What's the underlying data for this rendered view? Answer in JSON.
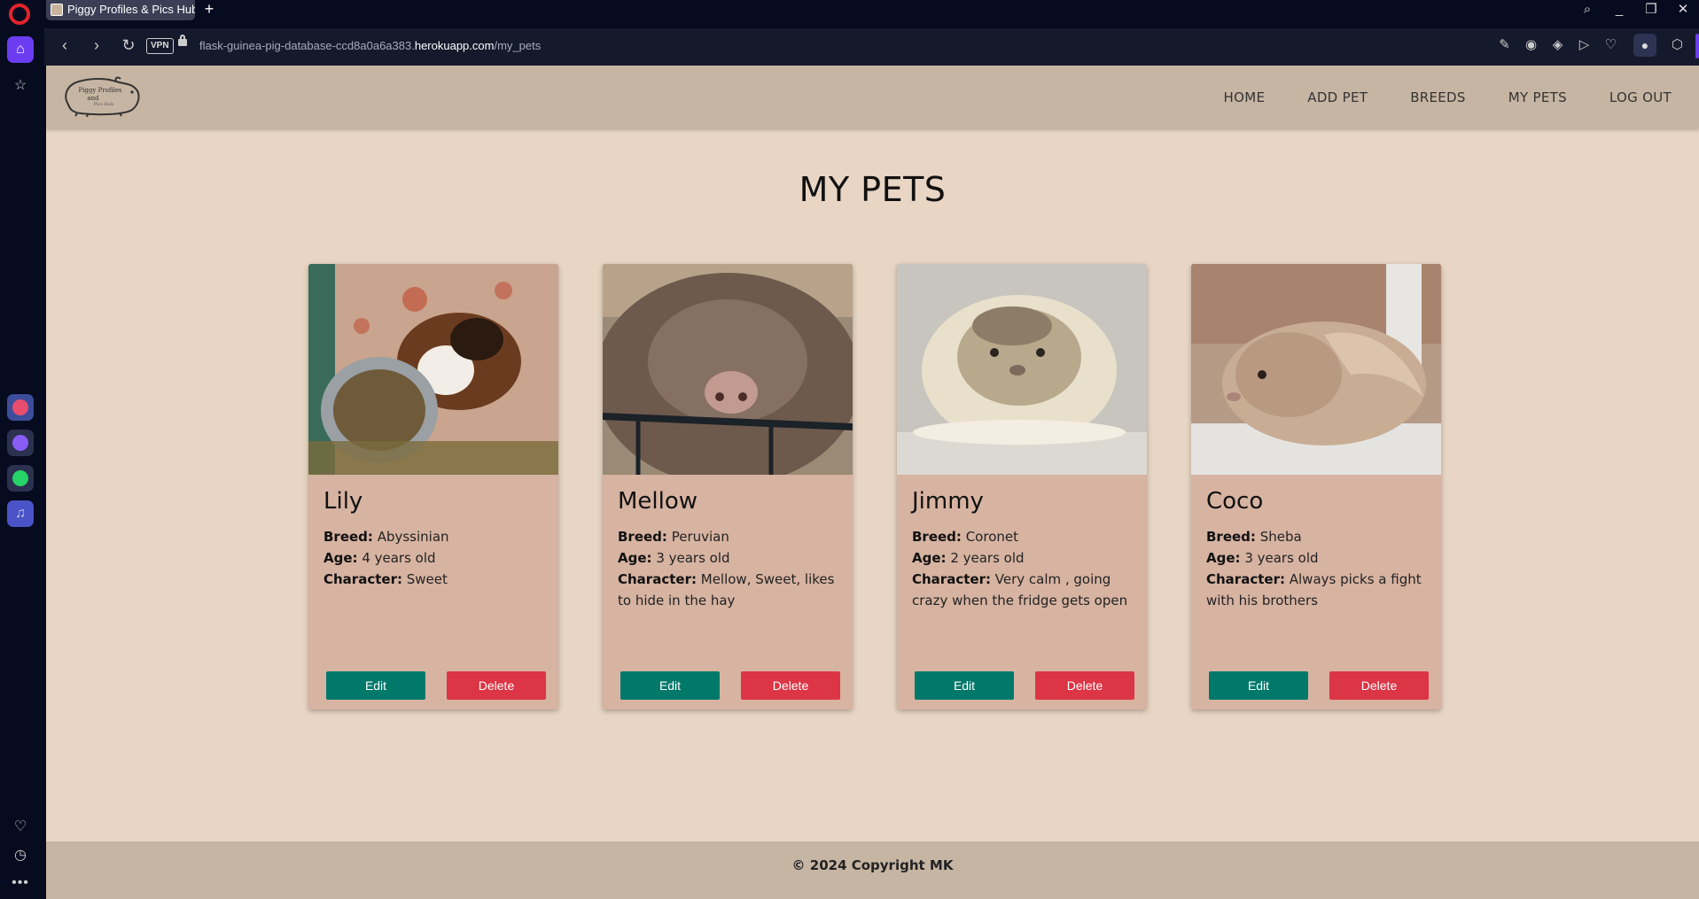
{
  "browser": {
    "tab_title": "Piggy Profiles & Pics Hub",
    "vpn_label": "VPN",
    "url_prefix": "flask-guinea-pig-database-ccd8a0a6a383.",
    "url_host": "herokuapp.com",
    "url_path": "/my_pets"
  },
  "navbar": {
    "logo_line1": "Piggy Profiles",
    "logo_line2": "and",
    "logo_line3": "Pics Hub",
    "links": [
      "HOME",
      "ADD PET",
      "BREEDS",
      "MY PETS",
      "LOG OUT"
    ]
  },
  "page_title": "MY PETS",
  "labels": {
    "breed": "Breed:",
    "age": "Age:",
    "character": "Character:",
    "edit": "Edit",
    "delete": "Delete"
  },
  "pets": [
    {
      "name": "Lily",
      "breed": "Abyssinian",
      "age": "4 years old",
      "character": "Sweet"
    },
    {
      "name": "Mellow",
      "breed": "Peruvian",
      "age": "3 years old",
      "character": "Mellow, Sweet, likes to hide in the hay"
    },
    {
      "name": "Jimmy",
      "breed": "Coronet",
      "age": "2 years old",
      "character": "Very calm , going crazy when the fridge gets open"
    },
    {
      "name": "Coco",
      "breed": "Sheba",
      "age": "3 years old",
      "character": "Always picks a fight with his brothers"
    }
  ],
  "footer": "© 2024 Copyright MK",
  "colors": {
    "page_bg": "#e8d5c4",
    "navbar_bg": "#c7b5a3",
    "card_bg": "#d7b3a1",
    "edit_btn": "#00786a",
    "delete_btn": "#dc3545"
  }
}
